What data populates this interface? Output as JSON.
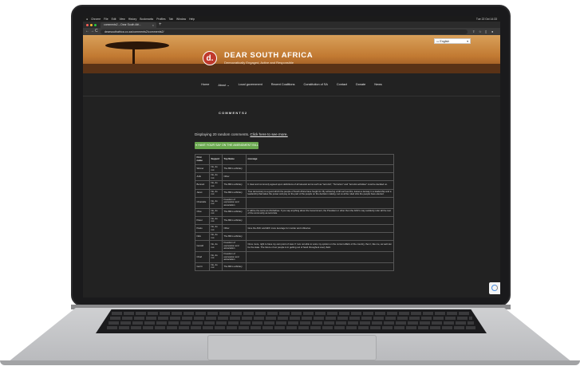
{
  "menubar": {
    "apple": "",
    "items": [
      "Chrome",
      "File",
      "Edit",
      "View",
      "History",
      "Bookmarks",
      "Profiles",
      "Tab",
      "Window",
      "Help"
    ],
    "clock": "Tue 22 Oct 14:33"
  },
  "browser": {
    "tab_title": "comments2 – Dear South Afri...",
    "tab_close": "×",
    "new_tab": "+",
    "url": "dearsouthafrica.co.za/comments2/comments2/",
    "back": "←",
    "forward": "→",
    "reload": "C"
  },
  "site": {
    "logo_letter": "d.",
    "title": "DEAR SOUTH AFRICA",
    "tagline": "Democratically Engaged, Active and Responsible",
    "language": "English",
    "nav": [
      "Home",
      "About",
      "Local government",
      "Recent Coalitions",
      "Constitution of SA",
      "Contact",
      "Donate",
      "News"
    ]
  },
  "page": {
    "title": "COMMENTS2",
    "intro_text": "Displaying 20 random comments.",
    "intro_link": "Click here to see more.",
    "cta": "HAVE YOUR SAY ON THE AMENDMENT BILL"
  },
  "table": {
    "headers": [
      "First name",
      "Support",
      "Top Name",
      "message"
    ],
    "rows": [
      {
        "name": "Winner",
        "support": "No, do not",
        "topic": "The Bill is arbitrary",
        "message": ""
      },
      {
        "name": "Anik",
        "support": "No, do not",
        "topic": "Other",
        "message": ""
      },
      {
        "name": "Bennett",
        "support": "No, do not",
        "topic": "The Bill is arbitrary",
        "message": "It clear and commonly agreed upon definitions of all relevant terms such as \"terrorist\", \"Terrorism\" and \"terrorist activities\" must be decided on."
      },
      {
        "name": "Janet",
        "support": "No, do not",
        "topic": "The Bill is arbitrary",
        "message": "True democracy is a good which the people of South Africa have fought for. By achieving a bill such as this, leaves a leeway in a leadership and a leadership that takes the power and pay on the part of the people on the decision making. Let us all be ruled who the people have elected."
      },
      {
        "name": "Chantelle",
        "support": "No, do not",
        "topic": "Freedom of expression and association",
        "message": ""
      },
      {
        "name": "Clive",
        "support": "No, do not",
        "topic": "The Bill is arbitrary",
        "message": "It will be the same as Zimbabwe. If you say anything about the Government, the President or other then the ANC's may suddenly refer all the rest of the community as terrorists."
      },
      {
        "name": "Pieter",
        "support": "No, do not",
        "topic": "The Bill is arbitrary",
        "message": ""
      },
      {
        "name": "Paolo",
        "support": "No, do not",
        "topic": "Other",
        "message": "Give the ANC and EFF more leverage for murder and robberies"
      },
      {
        "name": "Nick",
        "support": "No, do not",
        "topic": "The Bill is arbitrary",
        "message": ""
      },
      {
        "name": "Gerald",
        "support": "No, do not",
        "topic": "Freedom of expression and association",
        "message": "Once more, right to have my own point of view. If I am not able to voice my opinion on the current affairs of the country, then I, like me, as well can be the state. The future of our people is in getting out of hand throughout every field."
      },
      {
        "name": "Charl",
        "support": "No, do not",
        "topic": "Freedom of expression and association",
        "message": ""
      },
      {
        "name": "Gerrit",
        "support": "No, do not",
        "topic": "The Bill is arbitrary",
        "message": ""
      }
    ]
  }
}
